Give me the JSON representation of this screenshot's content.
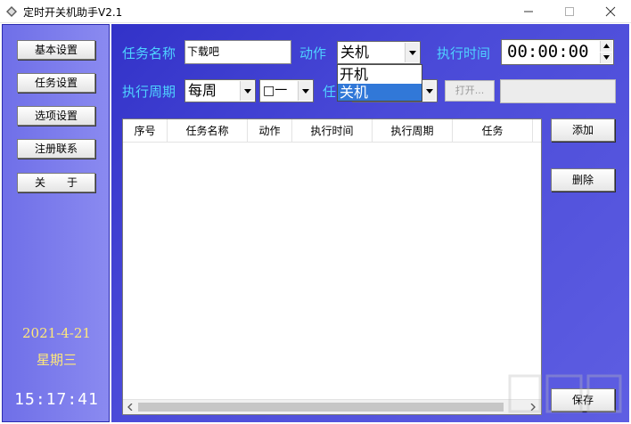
{
  "window": {
    "title": "定时开关机助手V2.1",
    "icon": "diamond-app-icon",
    "controls": [
      "minimize",
      "maximize",
      "close"
    ]
  },
  "sidebar": {
    "buttons": [
      {
        "label": "基本设置"
      },
      {
        "label": "任务设置"
      },
      {
        "label": "选项设置"
      },
      {
        "label": "注册联系"
      },
      {
        "label": "关　　于"
      }
    ],
    "date": "2021-4-21",
    "weekday": "星期三",
    "clock": "15:17:41"
  },
  "form": {
    "task_name_label": "任务名称",
    "task_name_value": "下载吧",
    "action_label": "动作",
    "action_value": "关机",
    "action_options": [
      "开机",
      "关机"
    ],
    "action_selected_option": "关机",
    "exec_time_label": "执行时间",
    "exec_time_value": "00:00:00",
    "period_label": "执行周期",
    "period_value": "每周",
    "weekday_value": "□一",
    "task_label_partial": "任",
    "open_button": "打开..."
  },
  "table": {
    "columns": [
      "序号",
      "任务名称",
      "动作",
      "执行时间",
      "执行周期",
      "任务"
    ],
    "rows": []
  },
  "actions": {
    "add": "添加",
    "delete": "删除",
    "save": "保存"
  },
  "colors": {
    "sidebar_bg": "#7d7dec",
    "main_bg": "#3a3acc",
    "label_cyan": "#4fd2ff",
    "date_yellow": "#ffe87a",
    "selection_blue": "#3178d8"
  }
}
